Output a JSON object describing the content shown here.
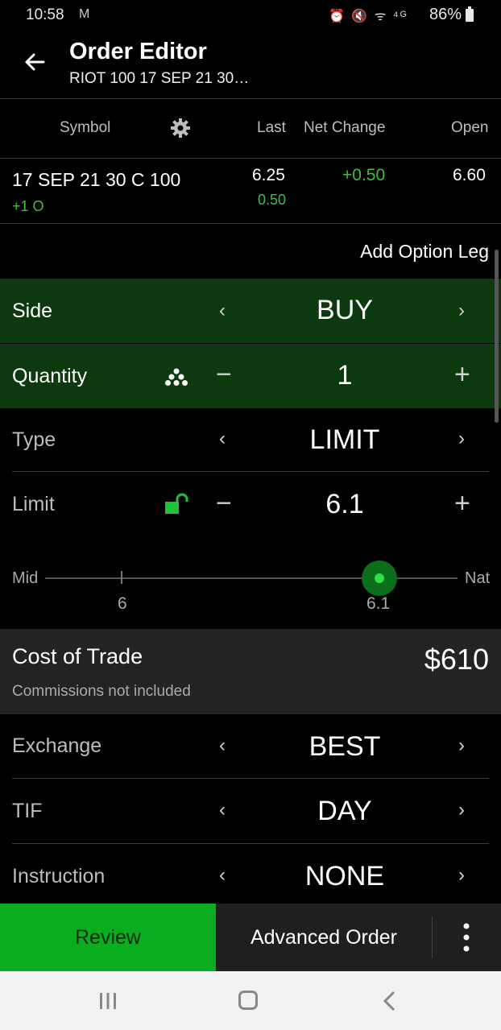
{
  "status": {
    "time": "10:58",
    "mail_glyph": "M",
    "network_glyphs": "⏰ 🔇 ᯤ ⁴ᴳ",
    "battery": "86%"
  },
  "header": {
    "title": "Order Editor",
    "subtitle": "RIOT 100 17 SEP 21 30…"
  },
  "table": {
    "columns": [
      "Symbol",
      "Last",
      "Net Change",
      "Open"
    ],
    "row": {
      "symbol": "17 SEP 21 30 C 100",
      "position": "+1 O",
      "last": "6.25",
      "last_sub": "0.50",
      "net_change": "+0.50",
      "open": "6.60"
    }
  },
  "add_option_leg": "Add Option Leg",
  "form": {
    "side": {
      "label": "Side",
      "value": "BUY"
    },
    "quantity": {
      "label": "Quantity",
      "value": "1"
    },
    "type": {
      "label": "Type",
      "value": "LIMIT"
    },
    "limit": {
      "label": "Limit",
      "value": "6.1"
    }
  },
  "slider": {
    "left_label": "Mid",
    "right_label": "Nat",
    "tick_mid_value": "6",
    "thumb_value": "6.1",
    "position_fraction": 0.81
  },
  "cost": {
    "label": "Cost of Trade",
    "value": "$610",
    "note": "Commissions not included"
  },
  "exchange": {
    "label": "Exchange",
    "value": "BEST"
  },
  "tif": {
    "label": "TIF",
    "value": "DAY"
  },
  "instruction": {
    "label": "Instruction",
    "value": "NONE"
  },
  "bottom": {
    "review": "Review",
    "advanced": "Advanced Order"
  },
  "colors": {
    "accent_green": "#0aad1f",
    "row_green": "#0c3a0e",
    "positive": "#3fbf3f"
  }
}
